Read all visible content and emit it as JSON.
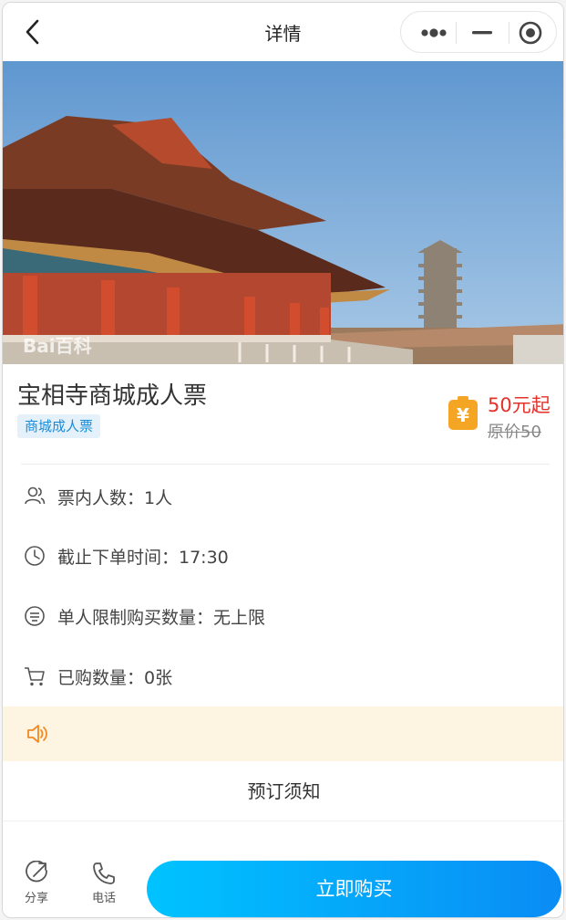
{
  "navbar": {
    "title": "详情"
  },
  "hero": {
    "watermark": "Bai百科"
  },
  "ticket": {
    "title": "宝相寺商城成人票",
    "tag": "商城成人票",
    "price": "50元起",
    "original_price": "原价50"
  },
  "info": [
    {
      "icon": "people-icon",
      "text": "票内人数：1人"
    },
    {
      "icon": "clock-icon",
      "text": "截止下单时间：17:30"
    },
    {
      "icon": "limit-icon",
      "text": "单人限制购买数量：无上限"
    },
    {
      "icon": "cart-icon",
      "text": "已购数量：0张"
    }
  ],
  "booking": {
    "label": "预订须知"
  },
  "bottom": {
    "share_label": "分享",
    "phone_label": "电话",
    "buy_label": "立即购买"
  },
  "colors": {
    "price": "#e4322b",
    "tag_text": "#1a8bd6",
    "tag_bg": "#e4f1fb",
    "notice_bg": "#fdf5e1",
    "notice_icon": "#f08a24",
    "buy_start": "#00c3ff",
    "buy_end": "#0a8cf5",
    "price_icon": "#f5a524"
  }
}
